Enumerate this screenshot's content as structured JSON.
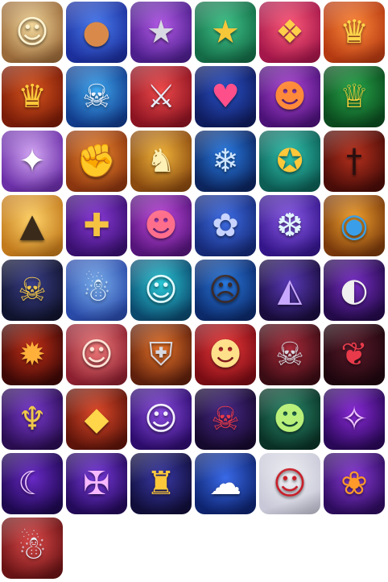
{
  "icons": [
    {
      "name": "golden-haired-hero-portrait-icon",
      "bg1": "#f3d89a",
      "bg2": "#9a6a3a",
      "fg": "#fff3cf",
      "glyph": "☺"
    },
    {
      "name": "bronze-medal-icon",
      "bg1": "#4a7df0",
      "bg2": "#1c2f9c",
      "fg": "#d98a4a",
      "glyph": "●"
    },
    {
      "name": "silver-star-medal-icon",
      "bg1": "#b55be8",
      "bg2": "#4d1f8c",
      "fg": "#d9d9e3",
      "glyph": "★"
    },
    {
      "name": "gold-star-medal-icon",
      "bg1": "#3fc48a",
      "bg2": "#146b46",
      "fg": "#f7c73a",
      "glyph": "★"
    },
    {
      "name": "winged-crest-emblem-icon",
      "bg1": "#ff5b7a",
      "bg2": "#a4174a",
      "fg": "#ffcf4a",
      "glyph": "❖"
    },
    {
      "name": "golden-shield-crown-icon",
      "bg1": "#ff8a3a",
      "bg2": "#b53a12",
      "fg": "#ffd54a",
      "glyph": "♛"
    },
    {
      "name": "golden-crown-icon",
      "bg1": "#d9551e",
      "bg2": "#7a1c08",
      "fg": "#ffc83a",
      "glyph": "♛"
    },
    {
      "name": "skeletal-dragon-monster-icon",
      "bg1": "#3fa8f0",
      "bg2": "#123c8c",
      "fg": "#eef3ff",
      "glyph": "☠"
    },
    {
      "name": "crossed-swords-icon",
      "bg1": "#ef4a4a",
      "bg2": "#8c1422",
      "fg": "#e8eefc",
      "glyph": "⚔"
    },
    {
      "name": "winged-heart-icon",
      "bg1": "#2a52c8",
      "bg2": "#0f1c5e",
      "fg": "#ff4f8a",
      "glyph": "♥"
    },
    {
      "name": "orange-beast-monster-icon",
      "bg1": "#b147d8",
      "bg2": "#4c1278",
      "fg": "#ff8a3a",
      "glyph": "☻"
    },
    {
      "name": "golden-trophy-cup-icon",
      "bg1": "#27a84a",
      "bg2": "#0b4a1e",
      "fg": "#ffd23a",
      "glyph": "♕"
    },
    {
      "name": "white-fox-spirit-icon",
      "bg1": "#d5a8f5",
      "bg2": "#6b2fa8",
      "fg": "#ffffff",
      "glyph": "✦"
    },
    {
      "name": "golden-fist-emblem-icon",
      "bg1": "#f28a2e",
      "bg2": "#8c3610",
      "fg": "#ffd57a",
      "glyph": "✊"
    },
    {
      "name": "golden-deer-warrior-icon",
      "bg1": "#f2b53a",
      "bg2": "#8a4a10",
      "fg": "#fff0b5",
      "glyph": "♞"
    },
    {
      "name": "frost-wolf-beast-icon",
      "bg1": "#2a7ee8",
      "bg2": "#0c255e",
      "fg": "#cfe6ff",
      "glyph": "❄"
    },
    {
      "name": "golden-rune-sigil-icon",
      "bg1": "#2fc4b0",
      "bg2": "#0d5e55",
      "fg": "#ffc83a",
      "glyph": "✪"
    },
    {
      "name": "dark-flame-sword-icon",
      "bg1": "#b8321e",
      "bg2": "#4a0c08",
      "fg": "#2a0f0f",
      "glyph": "†"
    },
    {
      "name": "golden-griffin-eagle-icon",
      "bg1": "#ffd36a",
      "bg2": "#c27a1c",
      "fg": "#3a2a1a",
      "glyph": "▲"
    },
    {
      "name": "crossed-shield-emblem-icon",
      "bg1": "#8a3ad8",
      "bg2": "#3a1070",
      "fg": "#f5c242",
      "glyph": "✚"
    },
    {
      "name": "pink-toad-monster-icon",
      "bg1": "#c44ae0",
      "bg2": "#55157a",
      "fg": "#ff6f8c",
      "glyph": "☻"
    },
    {
      "name": "rose-crown-armor-icon",
      "bg1": "#3f6fe8",
      "bg2": "#162a78",
      "fg": "#c8d4ff",
      "glyph": "✿"
    },
    {
      "name": "crystal-bunny-spirit-icon",
      "bg1": "#8a5ae8",
      "bg2": "#35168a",
      "fg": "#e0f4ff",
      "glyph": "❆"
    },
    {
      "name": "dragon-eye-orb-icon",
      "bg1": "#f2a22e",
      "bg2": "#7a3a0c",
      "fg": "#3a9fe8",
      "glyph": "◉"
    },
    {
      "name": "skeleton-king-icon",
      "bg1": "#3a3f8a",
      "bg2": "#11142e",
      "fg": "#f3c84a",
      "glyph": "☠"
    },
    {
      "name": "blue-furry-beast-icon",
      "bg1": "#7ab0f0",
      "bg2": "#2a4aa8",
      "fg": "#dff0ff",
      "glyph": "☃"
    },
    {
      "name": "cyan-ghost-girl-icon",
      "bg1": "#2acad8",
      "bg2": "#0c4a6e",
      "fg": "#e0fbff",
      "glyph": "☺"
    },
    {
      "name": "roaring-bear-icon",
      "bg1": "#2a7ae0",
      "bg2": "#0c2a6a",
      "fg": "#3a2a2a",
      "glyph": "☹"
    },
    {
      "name": "hooded-shadow-assassin-icon",
      "bg1": "#5a3ab8",
      "bg2": "#1a0d3e",
      "fg": "#c8a8ff",
      "glyph": "◭"
    },
    {
      "name": "masked-dark-lord-icon",
      "bg1": "#7a2fc8",
      "bg2": "#240a4a",
      "fg": "#f0f0f0",
      "glyph": "◐"
    },
    {
      "name": "fanged-demon-maw-icon",
      "bg1": "#c43018",
      "bg2": "#3e0806",
      "fg": "#ffb03a",
      "glyph": "✹"
    },
    {
      "name": "elf-maiden-profile-icon",
      "bg1": "#f07a7a",
      "bg2": "#8c2030",
      "fg": "#ffe3d5",
      "glyph": "☺"
    },
    {
      "name": "armored-knight-helm-icon",
      "bg1": "#e8742a",
      "bg2": "#5e200c",
      "fg": "#d8d8e0",
      "glyph": "⛨"
    },
    {
      "name": "lion-dance-mask-icon",
      "bg1": "#f03a3a",
      "bg2": "#7a0c14",
      "fg": "#ffe08a",
      "glyph": "☻"
    },
    {
      "name": "spiked-skull-shield-icon",
      "bg1": "#a82a3a",
      "bg2": "#3a0c14",
      "fg": "#d8d8e0",
      "glyph": "☠"
    },
    {
      "name": "demon-wing-scroll-icon",
      "bg1": "#5a1a2a",
      "bg2": "#1e060e",
      "fg": "#e83a4a",
      "glyph": "❦"
    },
    {
      "name": "horned-skull-crest-icon",
      "bg1": "#7a3ad0",
      "bg2": "#2a0d52",
      "fg": "#f0c84a",
      "glyph": "♆"
    },
    {
      "name": "golden-crystal-cluster-icon",
      "bg1": "#e04a2a",
      "bg2": "#5e140a",
      "fg": "#ffd54a",
      "glyph": "◆"
    },
    {
      "name": "white-haired-girl-icon",
      "bg1": "#8a4ae0",
      "bg2": "#2e0d6e",
      "fg": "#f4f0ff",
      "glyph": "☺"
    },
    {
      "name": "crimson-skull-warlord-icon",
      "bg1": "#4a2a8a",
      "bg2": "#16092e",
      "fg": "#e83a4a",
      "glyph": "☠"
    },
    {
      "name": "green-goblin-warrior-icon",
      "bg1": "#2a8a6a",
      "bg2": "#0a3226",
      "fg": "#b8f07a",
      "glyph": "☻"
    },
    {
      "name": "violet-void-sigil-icon",
      "bg1": "#8a2ad8",
      "bg2": "#2a0858",
      "fg": "#f0c8ff",
      "glyph": "✧"
    },
    {
      "name": "purple-crescent-orb-icon",
      "bg1": "#6a2ac8",
      "bg2": "#1e0850",
      "fg": "#f0c8ff",
      "glyph": "☾"
    },
    {
      "name": "violet-cross-rune-icon",
      "bg1": "#7a3ae0",
      "bg2": "#240a5a",
      "fg": "#f7b8ff",
      "glyph": "✠"
    },
    {
      "name": "horned-samurai-mask-icon",
      "bg1": "#3a3aa8",
      "bg2": "#110e3a",
      "fg": "#ffc83a",
      "glyph": "♜"
    },
    {
      "name": "white-rabbit-cloud-icon",
      "bg1": "#3a6ae8",
      "bg2": "#0e2470",
      "fg": "#ffffff",
      "glyph": "☁"
    },
    {
      "name": "red-haired-vampire-girl-icon",
      "bg1": "#f0f0f4",
      "bg2": "#c8c8d8",
      "fg": "#c8202a",
      "glyph": "☺"
    },
    {
      "name": "harvest-pumpkin-cornucopia-icon",
      "bg1": "#8a3ad8",
      "bg2": "#2e0c5e",
      "fg": "#ff9a2a",
      "glyph": "❀"
    },
    {
      "name": "santa-hat-turtle-beast-icon",
      "bg1": "#e04a4a",
      "bg2": "#6a1416",
      "fg": "#e8f4ff",
      "glyph": "☃"
    }
  ]
}
